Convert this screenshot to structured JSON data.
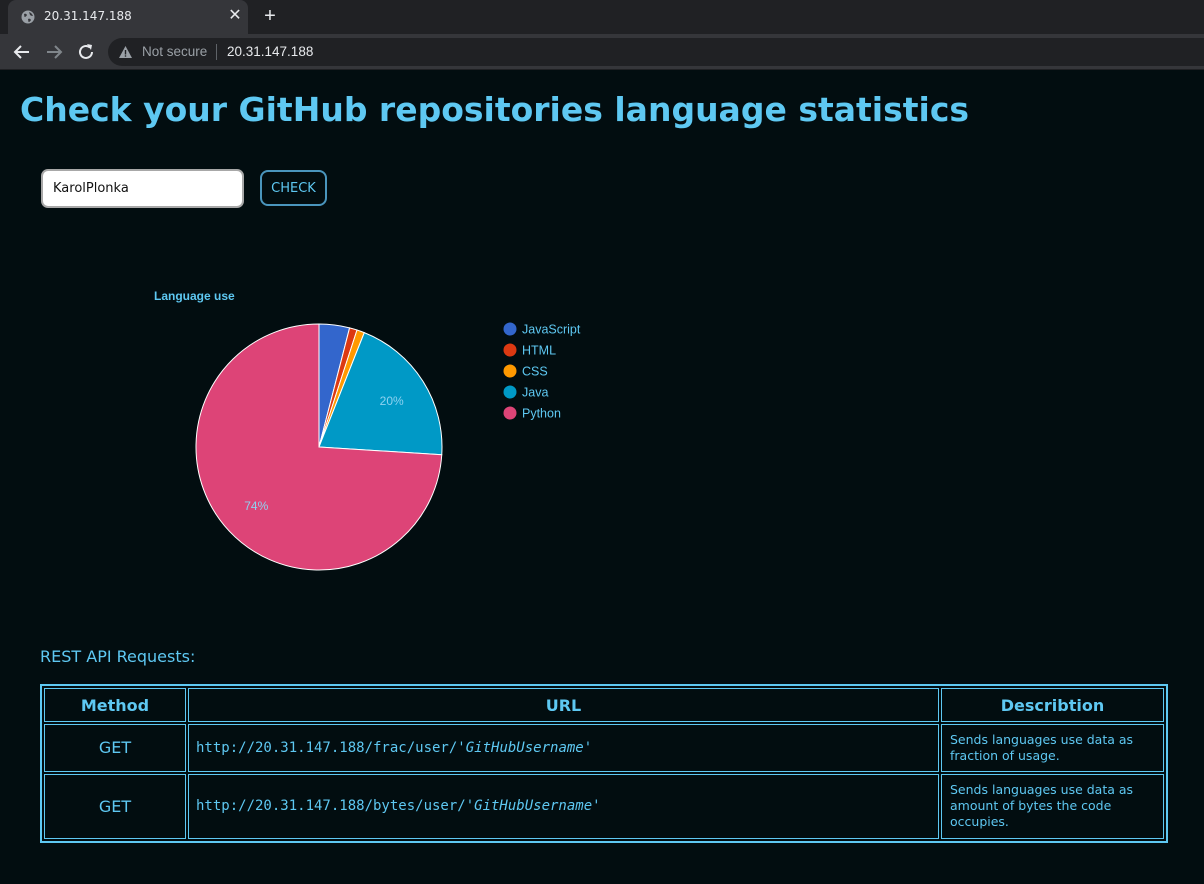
{
  "browser": {
    "tab_title": "20.31.147.188",
    "tab_favicon": "globe-icon",
    "close_glyph": "✕",
    "new_tab_glyph": "+",
    "not_secure_label": "Not secure",
    "url": "20.31.147.188"
  },
  "page": {
    "title": "Check your GitHub repositories language statistics",
    "username_value": "KarolPlonka",
    "check_label": "CHECK",
    "rest_heading": "REST API Requests:"
  },
  "table": {
    "headers": [
      "Method",
      "URL",
      "Describtion"
    ],
    "rows": [
      {
        "method": "GET",
        "url_prefix": "http://20.31.147.188/frac/user/",
        "url_param": "'GitHubUsername'",
        "description": "Sends languages use data as fraction of usage."
      },
      {
        "method": "GET",
        "url_prefix": "http://20.31.147.188/bytes/user/",
        "url_param": "'GitHubUsername'",
        "description": "Sends languages use data as amount of bytes the code occupies."
      }
    ]
  },
  "chart_data": {
    "type": "pie",
    "title": "Language use",
    "legend_position": "right",
    "categories": [
      "JavaScript",
      "HTML",
      "CSS",
      "Java",
      "Python"
    ],
    "values": [
      4,
      1,
      1,
      20,
      74
    ],
    "colors": [
      "#3366cc",
      "#dc3912",
      "#ff9900",
      "#0099c6",
      "#dd4477"
    ],
    "visible_labels": [
      "",
      "",
      "",
      "20%",
      "74%"
    ]
  },
  "colors": {
    "accent": "#5ec8f2",
    "background": "#020d10"
  }
}
